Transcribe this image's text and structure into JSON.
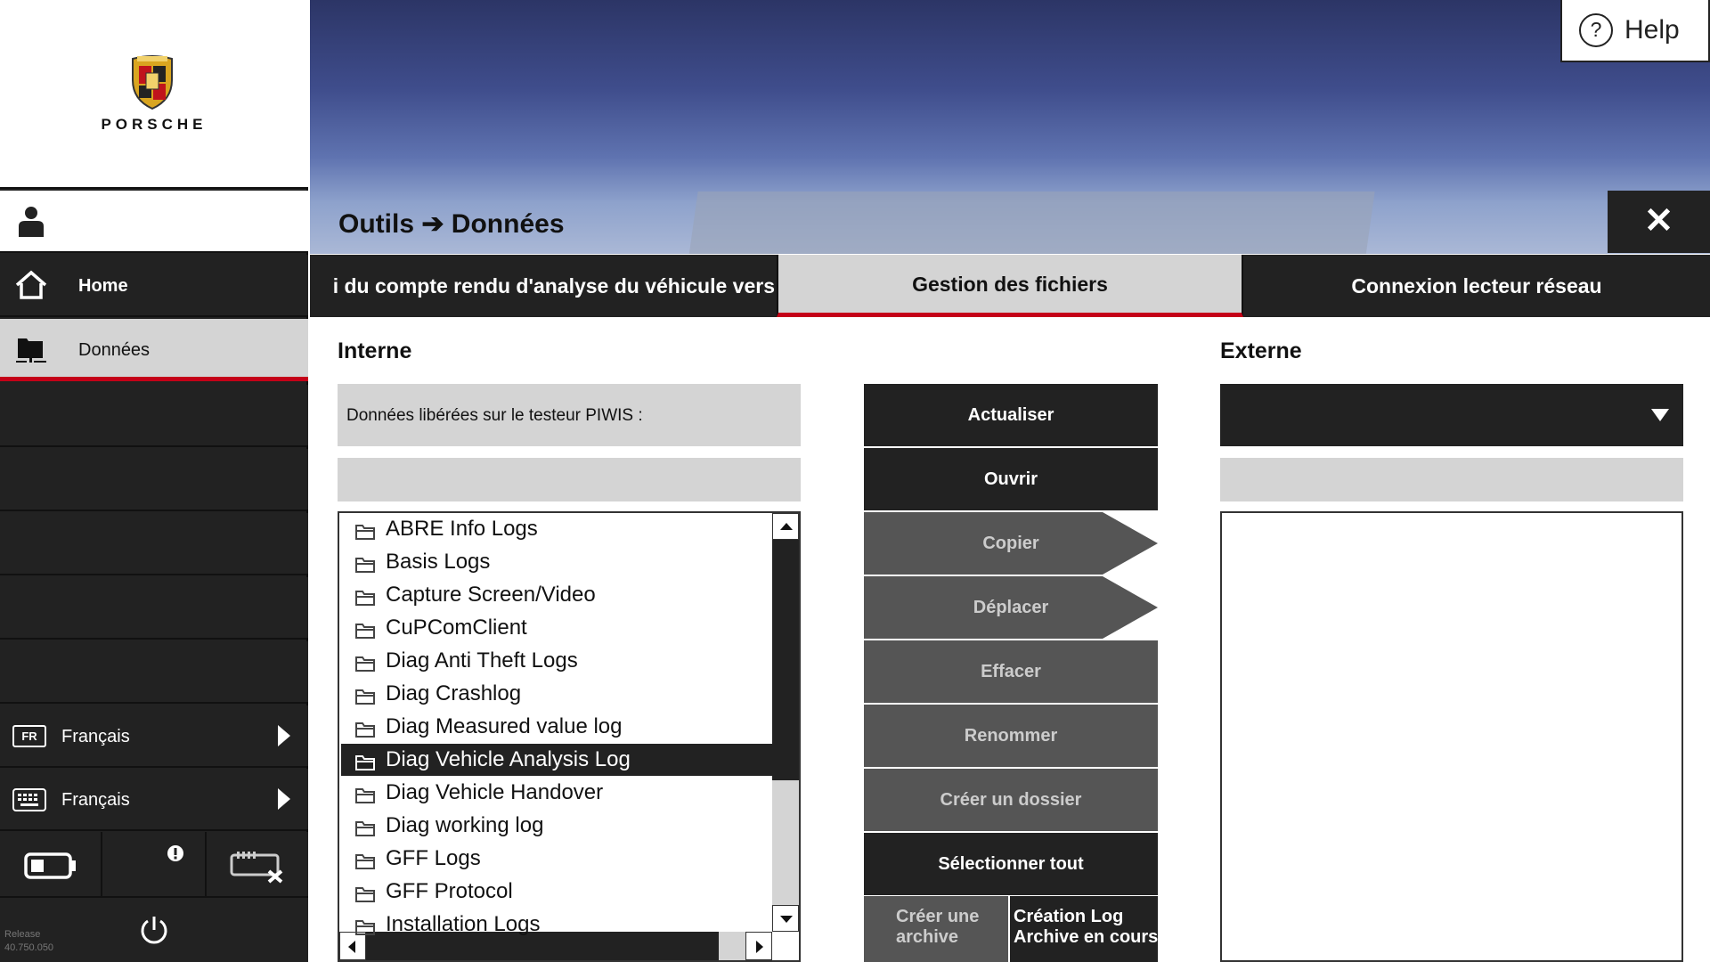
{
  "brand": {
    "name": "PORSCHE"
  },
  "sidebar": {
    "nav": [
      {
        "label": "Home",
        "icon": "home-icon"
      },
      {
        "label": "Données",
        "icon": "data-folder-icon"
      }
    ],
    "language": {
      "code": "FR",
      "label": "Français"
    },
    "keyboard": {
      "label": "Français"
    },
    "release": {
      "line1": "Release",
      "line2": "40.750.050"
    }
  },
  "header": {
    "help_label": "Help",
    "breadcrumb": "Outils ➔ Données"
  },
  "tabs": [
    {
      "label": "i du compte rendu d'analyse du véhicule vers"
    },
    {
      "label": "Gestion des fichiers",
      "active": true
    },
    {
      "label": "Connexion lecteur réseau"
    }
  ],
  "internal": {
    "heading": "Interne",
    "info": "Données libérées sur le testeur PIWIS :",
    "path": "",
    "files": [
      "ABRE Info Logs",
      "Basis Logs",
      "Capture Screen/Video",
      "CuPComClient",
      "Diag Anti Theft Logs",
      "Diag Crashlog",
      "Diag Measured value log",
      "Diag Vehicle Analysis Log",
      "Diag Vehicle Handover",
      "Diag working log",
      "GFF Logs",
      "GFF Protocol",
      "Installation Logs"
    ],
    "selected_index": 7
  },
  "actions": {
    "refresh": "Actualiser",
    "open": "Ouvrir",
    "copy": "Copier",
    "move": "Déplacer",
    "delete": "Effacer",
    "rename": "Renommer",
    "new_folder": "Créer un dossier",
    "select_all": "Sélectionner tout",
    "create_archive_1": "Créer une",
    "create_archive_2": "archive",
    "log_archive_1": "Création Log",
    "log_archive_2": "Archive en cours"
  },
  "external": {
    "heading": "Externe",
    "selected": "",
    "path": ""
  },
  "colors": {
    "accent": "#c40018",
    "dark": "#222222",
    "panel": "#d4d4d4"
  }
}
